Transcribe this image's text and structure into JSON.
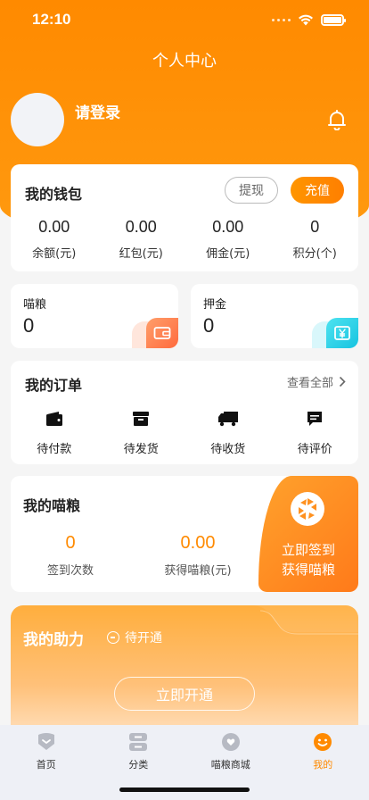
{
  "status_bar": {
    "time": "12:10"
  },
  "header": {
    "title": "个人中心",
    "login_text": "请登录"
  },
  "wallet": {
    "title": "我的钱包",
    "withdraw_label": "提现",
    "recharge_label": "充值",
    "stats": [
      {
        "value": "0.00",
        "label": "余额(元)"
      },
      {
        "value": "0.00",
        "label": "红包(元)"
      },
      {
        "value": "0.00",
        "label": "佣金(元)"
      },
      {
        "value": "0",
        "label": "积分(个)"
      }
    ]
  },
  "grain_card": {
    "label": "喵粮",
    "value": "0"
  },
  "deposit_card": {
    "label": "押金",
    "value": "0"
  },
  "orders": {
    "title": "我的订单",
    "view_all": "查看全部",
    "items": [
      {
        "label": "待付款",
        "icon": "wallet-icon"
      },
      {
        "label": "待发货",
        "icon": "package-icon"
      },
      {
        "label": "待收货",
        "icon": "truck-icon"
      },
      {
        "label": "待评价",
        "icon": "comment-icon"
      }
    ]
  },
  "my_grain": {
    "title": "我的喵粮",
    "checkin_count": "0",
    "checkin_label": "签到次数",
    "earned": "0.00",
    "earned_label": "获得喵粮(元)",
    "cta_line1": "立即签到",
    "cta_line2": "获得喵粮"
  },
  "assist": {
    "title": "我的助力",
    "status": "待开通",
    "activate_label": "立即开通"
  },
  "tabbar": {
    "items": [
      {
        "label": "首页",
        "icon": "home-icon"
      },
      {
        "label": "分类",
        "icon": "category-icon"
      },
      {
        "label": "喵粮商城",
        "icon": "mall-icon"
      },
      {
        "label": "我的",
        "icon": "profile-icon"
      }
    ],
    "active_index": 3
  },
  "colors": {
    "primary": "#ff8a00",
    "recharge_gradient_end": "#ff7f00",
    "grain_icon_bg": "#ff7a4d",
    "deposit_icon_bg": "#2ad1e8"
  }
}
